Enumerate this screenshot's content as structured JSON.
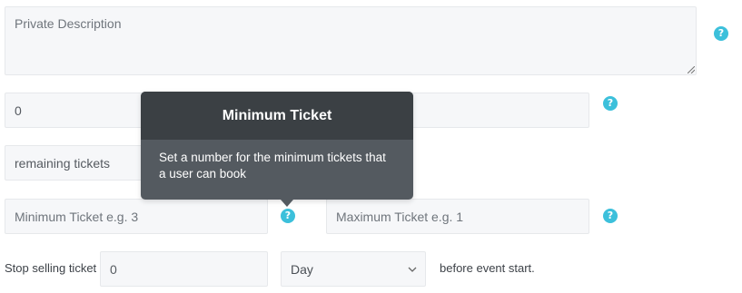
{
  "private_description": {
    "placeholder": "Private Description",
    "value": ""
  },
  "row2": {
    "left_value": "0",
    "right_value": ""
  },
  "remaining": {
    "value": "remaining tickets"
  },
  "min_ticket": {
    "placeholder": "Minimum Ticket e.g. 3"
  },
  "max_ticket": {
    "placeholder": "Maximum Ticket e.g. 1"
  },
  "stop_selling": {
    "label": "Stop selling ticket",
    "value": "0",
    "unit_selected": "Day",
    "suffix": "before event start."
  },
  "help_glyph": "?",
  "tooltip": {
    "title": "Minimum Ticket",
    "body": "Set a number for the minimum tickets that a user can book"
  },
  "colors": {
    "accent": "#3cc0db",
    "field_bg": "#f6f7f9",
    "tooltip_head": "#3b4044",
    "tooltip_body": "#545a60"
  }
}
